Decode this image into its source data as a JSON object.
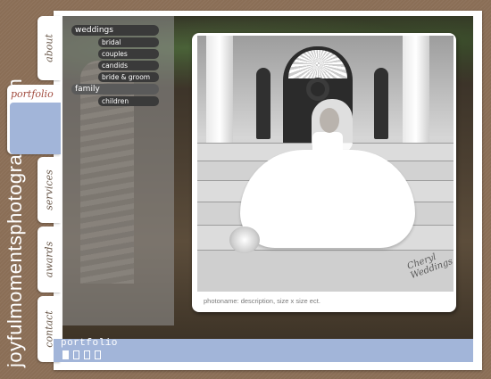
{
  "site": {
    "name": "joyfulmomentsphotography.com"
  },
  "tabs": [
    {
      "label": "about",
      "active": false
    },
    {
      "label": "portfolio",
      "active": true
    },
    {
      "label": "services",
      "active": false
    },
    {
      "label": "awards",
      "active": false
    },
    {
      "label": "contact",
      "active": false
    }
  ],
  "nav": {
    "categories": [
      {
        "label": "weddings",
        "items": [
          "bridal",
          "couples",
          "candids",
          "bride & groom"
        ]
      },
      {
        "label": "family",
        "items": [
          "children"
        ]
      }
    ]
  },
  "photo": {
    "caption": "photoname: description, size x size ect.",
    "signature": "Cheryl Weddings"
  },
  "bottom": {
    "title": "portfolio",
    "pages": 4,
    "current_page": 1
  },
  "colors": {
    "background": "#8a6e56",
    "accent_blue": "#a2b5d9",
    "nav_pill": "#3a3a3a",
    "active_tab_text": "#a14b3e"
  }
}
